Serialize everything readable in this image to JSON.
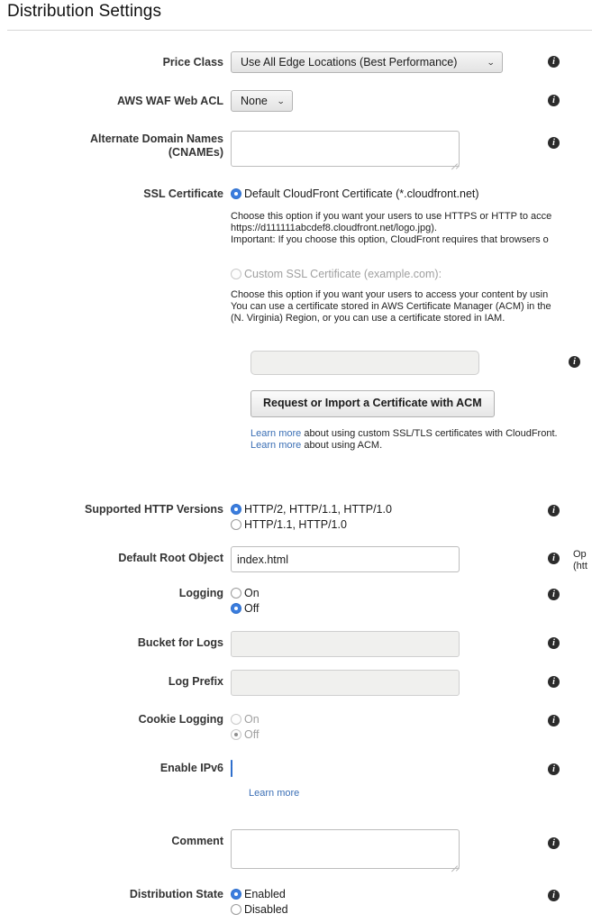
{
  "page": {
    "title": "Distribution Settings"
  },
  "icons": {
    "info": "i",
    "caret_down": "⌄"
  },
  "rows": {
    "price_class": {
      "label": "Price Class",
      "value": "Use All Edge Locations (Best Performance)"
    },
    "waf_acl": {
      "label": "AWS WAF Web ACL",
      "value": "None"
    },
    "cnames": {
      "label_line1": "Alternate Domain Names",
      "label_line2": "(CNAMEs)",
      "value": "",
      "placeholder": ""
    },
    "ssl_certificate": {
      "label": "SSL Certificate",
      "default_option": {
        "label": "Default CloudFront Certificate (*.cloudfront.net)",
        "selected": true,
        "description_lines": [
          "Choose this option if you want your users to use HTTPS or HTTP to acce",
          "https://d111111abcdef8.cloudfront.net/logo.jpg).",
          "Important: If you choose this option, CloudFront requires that browsers o"
        ]
      },
      "custom_option": {
        "label": "Custom SSL Certificate (example.com):",
        "selected": false,
        "disabled": true,
        "description_lines": [
          "Choose this option if you want your users to access your content by usin",
          "You can use a certificate stored in AWS Certificate Manager (ACM) in the",
          "(N. Virginia) Region, or you can use a certificate stored in IAM."
        ]
      },
      "certificate_input": {
        "value": "",
        "placeholder": "",
        "disabled": true
      },
      "acm_button": "Request or Import a Certificate with ACM",
      "links": [
        {
          "link_text": "Learn more",
          "rest": " about using custom SSL/TLS certificates with CloudFront."
        },
        {
          "link_text": "Learn more",
          "rest": " about using ACM."
        }
      ]
    },
    "http_versions": {
      "label": "Supported HTTP Versions",
      "options": [
        {
          "label": "HTTP/2, HTTP/1.1, HTTP/1.0",
          "selected": true
        },
        {
          "label": "HTTP/1.1, HTTP/1.0",
          "selected": false
        }
      ]
    },
    "default_root_object": {
      "label": "Default Root Object",
      "value": "index.html",
      "placeholder": "",
      "side_note_lines": [
        "Op",
        "(htt"
      ]
    },
    "logging": {
      "label": "Logging",
      "options": [
        {
          "label": "On",
          "selected": false
        },
        {
          "label": "Off",
          "selected": true
        }
      ]
    },
    "bucket_for_logs": {
      "label": "Bucket for Logs",
      "value": "",
      "placeholder": "",
      "disabled": true
    },
    "log_prefix": {
      "label": "Log Prefix",
      "value": "",
      "placeholder": "",
      "disabled": true
    },
    "cookie_logging": {
      "label": "Cookie Logging",
      "disabled": true,
      "options": [
        {
          "label": "On",
          "selected": false
        },
        {
          "label": "Off",
          "selected": true
        }
      ]
    },
    "enable_ipv6": {
      "label": "Enable IPv6",
      "checked": true,
      "link_text": "Learn more"
    },
    "comment": {
      "label": "Comment",
      "value": "",
      "placeholder": ""
    },
    "distribution_state": {
      "label": "Distribution State",
      "options": [
        {
          "label": "Enabled",
          "selected": true
        },
        {
          "label": "Disabled",
          "selected": false
        }
      ]
    }
  }
}
